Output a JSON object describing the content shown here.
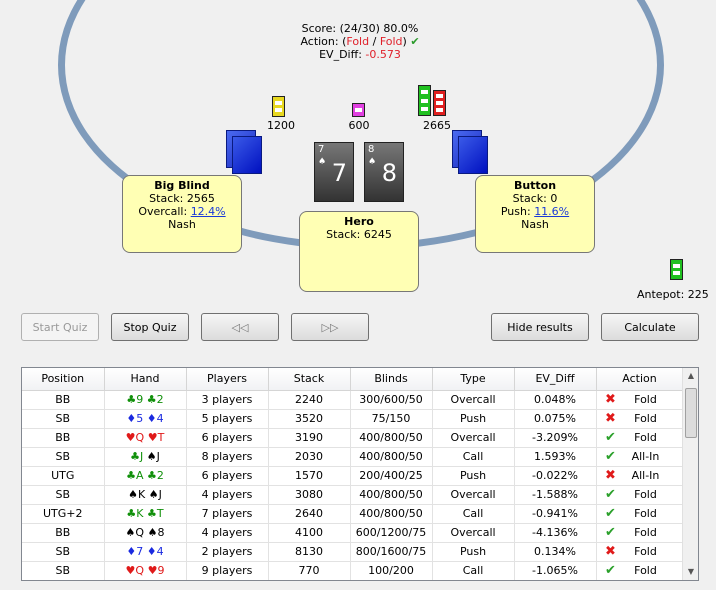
{
  "score": {
    "label": "Score:",
    "value": "(24/30) 80.0%",
    "action_label": "Action:",
    "action_open": "(",
    "action_a": "Fold",
    "action_sep": " / ",
    "action_b": "Fold",
    "action_close": ")",
    "check_icon": "✔",
    "ev_label": "EV_Diff:",
    "ev_value": "-0.573"
  },
  "bets": {
    "big_blind": "1200",
    "hero": "600",
    "button": "2665"
  },
  "players": {
    "big_blind": {
      "name": "Big Blind",
      "stack": "Stack: 2565",
      "stat_label": "Overcall:",
      "stat_value": "12.4%",
      "type": "Nash"
    },
    "hero": {
      "name": "Hero",
      "stack": "Stack: 6245"
    },
    "button": {
      "name": "Button",
      "stack": "Stack: 0",
      "stat_label": "Push:",
      "stat_value": "11.6%",
      "type": "Nash"
    }
  },
  "hero_cards": [
    {
      "rank": "7",
      "suit": "♠"
    },
    {
      "rank": "8",
      "suit": "♠"
    }
  ],
  "antepot": "Antepot: 225",
  "buttons": {
    "start_quiz": "Start Quiz",
    "stop_quiz": "Stop Quiz",
    "prev": "◁◁",
    "next": "▷▷",
    "hide_results": "Hide results",
    "calculate": "Calculate"
  },
  "columns": [
    "Position",
    "Hand",
    "Players",
    "Stack",
    "Blinds",
    "Type",
    "EV_Diff",
    "Action"
  ],
  "rows": [
    {
      "position": "BB",
      "hand": [
        {
          "s": "♣",
          "r": "9",
          "c": "club"
        },
        {
          "s": "♣",
          "r": "2",
          "c": "club"
        }
      ],
      "players": "3 players",
      "stack": "2240",
      "blinds": "300/600/50",
      "type": "Overcall",
      "ev": "0.048%",
      "ok": false,
      "action": "Fold"
    },
    {
      "position": "SB",
      "hand": [
        {
          "s": "♦",
          "r": "5",
          "c": "diamond"
        },
        {
          "s": "♦",
          "r": "4",
          "c": "diamond"
        }
      ],
      "players": "5 players",
      "stack": "3520",
      "blinds": "75/150",
      "type": "Push",
      "ev": "0.075%",
      "ok": false,
      "action": "Fold"
    },
    {
      "position": "BB",
      "hand": [
        {
          "s": "♥",
          "r": "Q",
          "c": "heart"
        },
        {
          "s": "♥",
          "r": "T",
          "c": "heart"
        }
      ],
      "players": "6 players",
      "stack": "3190",
      "blinds": "400/800/50",
      "type": "Overcall",
      "ev": "-3.209%",
      "ok": true,
      "action": "Fold"
    },
    {
      "position": "SB",
      "hand": [
        {
          "s": "♣",
          "r": "J",
          "c": "club"
        },
        {
          "s": "♠",
          "r": "J",
          "c": "spade"
        }
      ],
      "players": "8 players",
      "stack": "2030",
      "blinds": "400/800/50",
      "type": "Call",
      "ev": "1.593%",
      "ok": true,
      "action": "All-In"
    },
    {
      "position": "UTG",
      "hand": [
        {
          "s": "♣",
          "r": "A",
          "c": "club"
        },
        {
          "s": "♣",
          "r": "2",
          "c": "club"
        }
      ],
      "players": "6 players",
      "stack": "1570",
      "blinds": "200/400/25",
      "type": "Push",
      "ev": "-0.022%",
      "ok": false,
      "action": "All-In"
    },
    {
      "position": "SB",
      "hand": [
        {
          "s": "♠",
          "r": "K",
          "c": "spade"
        },
        {
          "s": "♠",
          "r": "J",
          "c": "spade"
        }
      ],
      "players": "4 players",
      "stack": "3080",
      "blinds": "400/800/50",
      "type": "Overcall",
      "ev": "-1.588%",
      "ok": true,
      "action": "Fold"
    },
    {
      "position": "UTG+2",
      "hand": [
        {
          "s": "♣",
          "r": "K",
          "c": "club"
        },
        {
          "s": "♣",
          "r": "T",
          "c": "club"
        }
      ],
      "players": "7 players",
      "stack": "2640",
      "blinds": "400/800/50",
      "type": "Call",
      "ev": "-0.941%",
      "ok": true,
      "action": "Fold"
    },
    {
      "position": "BB",
      "hand": [
        {
          "s": "♠",
          "r": "Q",
          "c": "spade"
        },
        {
          "s": "♠",
          "r": "8",
          "c": "spade"
        }
      ],
      "players": "4 players",
      "stack": "4100",
      "blinds": "600/1200/75",
      "type": "Overcall",
      "ev": "-4.136%",
      "ok": true,
      "action": "Fold"
    },
    {
      "position": "SB",
      "hand": [
        {
          "s": "♦",
          "r": "7",
          "c": "diamond"
        },
        {
          "s": "♦",
          "r": "4",
          "c": "diamond"
        }
      ],
      "players": "2 players",
      "stack": "8130",
      "blinds": "800/1600/75",
      "type": "Push",
      "ev": "0.134%",
      "ok": false,
      "action": "Fold"
    },
    {
      "position": "SB",
      "hand": [
        {
          "s": "♥",
          "r": "Q",
          "c": "heart"
        },
        {
          "s": "♥",
          "r": "9",
          "c": "heart"
        }
      ],
      "players": "9 players",
      "stack": "770",
      "blinds": "100/200",
      "type": "Call",
      "ev": "-1.065%",
      "ok": true,
      "action": "Fold"
    }
  ],
  "icons": {
    "ok": "check-icon",
    "bad": "cross-icon"
  }
}
